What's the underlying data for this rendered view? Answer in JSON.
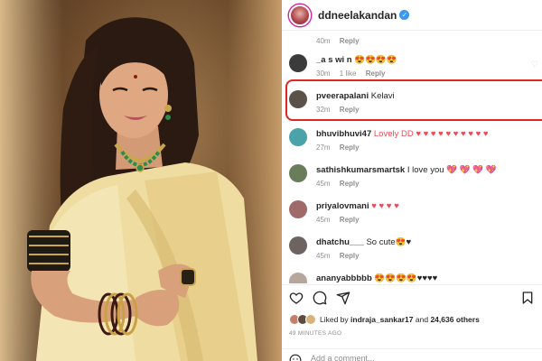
{
  "post": {
    "username": "ddneelakandan",
    "verified_glyph": "✓",
    "photo_semantic": "woman in cream silk saree with green necklace"
  },
  "comments": [
    {
      "username": "",
      "text": "",
      "time": "40m",
      "likes": "",
      "reply": "Reply",
      "avatar_color": "#9e8f86"
    },
    {
      "username": "_a s wi n",
      "text": "😍😍😍😍",
      "time": "30m",
      "likes": "1 like",
      "reply": "Reply",
      "avatar_color": "#3b3b3b"
    },
    {
      "username": "pveerapalani",
      "text": "Kelavi",
      "time": "32m",
      "likes": "",
      "reply": "Reply",
      "avatar_color": "#5a5148"
    },
    {
      "username": "bhuvibhuvi47",
      "text": "Lovely DD ♥ ♥ ♥ ♥ ♥ ♥ ♥ ♥ ♥ ♥",
      "time": "27m",
      "likes": "",
      "reply": "Reply",
      "avatar_color": "#4aa3a8"
    },
    {
      "username": "sathishkumarsmartsk",
      "text": "I love you 💖 💖 💖 💖",
      "time": "45m",
      "likes": "",
      "reply": "Reply",
      "avatar_color": "#6a7d5a"
    },
    {
      "username": "priyalovmani",
      "text": "♥ ♥ ♥ ♥",
      "time": "45m",
      "likes": "",
      "reply": "Reply",
      "avatar_color": "#a06a6a"
    },
    {
      "username": "dhatchu___",
      "text": "So cute😍♥",
      "time": "45m",
      "likes": "",
      "reply": "Reply",
      "avatar_color": "#6d6462"
    },
    {
      "username": "ananyabbbbb",
      "text": "😍😍😍😍♥♥♥♥",
      "time": "",
      "likes": "",
      "reply": "",
      "avatar_color": "#b7a69b"
    }
  ],
  "footer": {
    "liked_prefix": "Liked by ",
    "liked_user": "indraja_sankar17",
    "liked_mid": " and ",
    "liked_count": "24,636 others",
    "posted_time": "49 MINUTES AGO",
    "add_comment_placeholder": "Add a comment..."
  },
  "colors": {
    "highlight": "#e0261e",
    "heart_red": "#ed4956",
    "verified_blue": "#3897f0"
  },
  "icons": [
    "heart-icon",
    "comment-icon",
    "share-icon",
    "bookmark-icon",
    "emoji-icon",
    "verified-icon"
  ]
}
